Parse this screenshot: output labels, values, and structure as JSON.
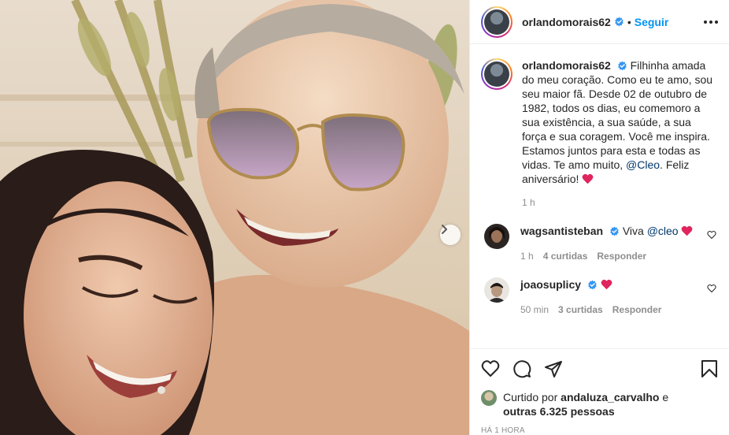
{
  "post": {
    "author": "orlandomorais62",
    "follow_label": "Seguir",
    "dot": "•",
    "caption": "Filhinha amada do meu coração. Como eu te amo, sou seu maior fã. Desde 02 de outubro de 1982, todos os dias, eu comemoro a sua existência, a sua saúde, a sua força e sua coragem. Você me inspira. Estamos juntos para esta e todas as vidas. Te amo muito,",
    "caption_mention": "@Cleo",
    "caption_end": ". Feliz aniversário!",
    "caption_time": "1 h"
  },
  "comments": [
    {
      "user": "wagsantisteban",
      "text": "Viva",
      "mention": "@cleo",
      "time": "1 h",
      "likes": "4 curtidas",
      "reply": "Responder"
    },
    {
      "user": "joaosuplicy",
      "text": "",
      "time": "50 min",
      "likes": "3 curtidas",
      "reply": "Responder"
    }
  ],
  "likes": {
    "prefix": "Curtido por",
    "liker": "andaluza_carvalho",
    "and": "e",
    "others": "outras 6.325 pessoas"
  },
  "timestamp": "HÁ 1 HORA",
  "colors": {
    "accent": "#0095f6",
    "heart": "#ed4956",
    "verified": "#3897f0",
    "muted": "#8e8e8e"
  },
  "icons": [
    "verified-badge-icon",
    "more-options-icon",
    "heart-icon",
    "comment-icon",
    "share-icon",
    "bookmark-icon",
    "chevron-right-icon"
  ]
}
